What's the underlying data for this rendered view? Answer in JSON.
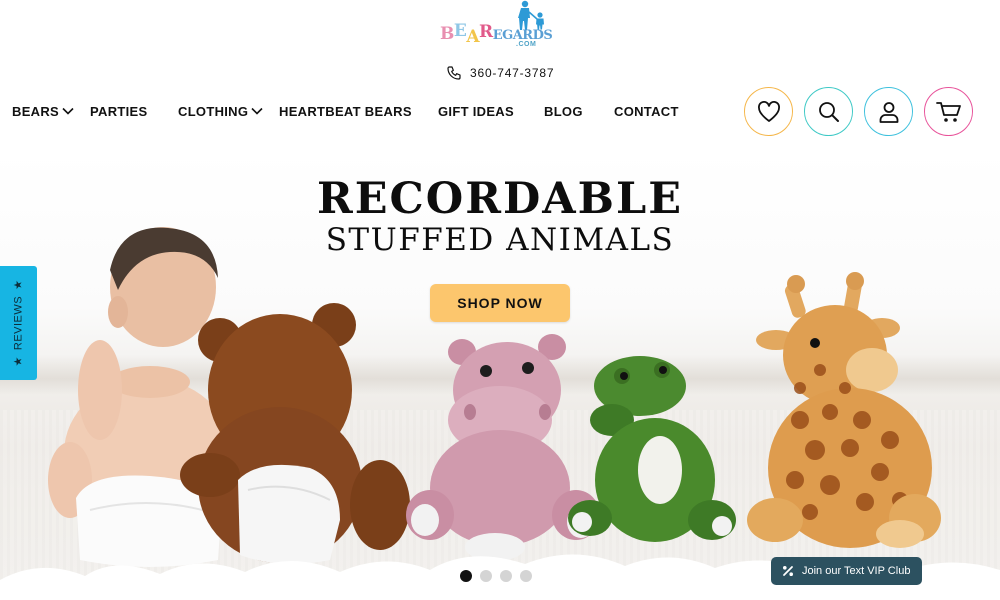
{
  "header": {
    "logo_alt": "BeaRegards.com",
    "logo_letters": [
      {
        "char": "B",
        "color": "#e88fb0"
      },
      {
        "char": "E",
        "color": "#8fc7e6"
      },
      {
        "char": "A",
        "color": "#f2c54a"
      },
      {
        "char": "R",
        "color": "#e15a8a"
      },
      {
        "char": "EGARDS",
        "color": "#5a9fd4"
      }
    ],
    "logo_com": ".COM",
    "phone": "360-747-3787"
  },
  "nav": {
    "items": [
      {
        "label": "BEARS",
        "has_dropdown": true
      },
      {
        "label": "PARTIES",
        "has_dropdown": false
      },
      {
        "label": "CLOTHING",
        "has_dropdown": true
      },
      {
        "label": "HEARTBEAT BEARS",
        "has_dropdown": false
      },
      {
        "label": "GIFT IDEAS",
        "has_dropdown": false
      },
      {
        "label": "BLOG",
        "has_dropdown": false
      },
      {
        "label": "CONTACT",
        "has_dropdown": false
      }
    ]
  },
  "actions": {
    "wishlist": {
      "icon": "heart-icon",
      "color": "#f5b649"
    },
    "search": {
      "icon": "search-icon",
      "color": "#3ec9c6"
    },
    "account": {
      "icon": "user-icon",
      "color": "#3ec1dd"
    },
    "cart": {
      "icon": "cart-icon",
      "color": "#e8539a"
    }
  },
  "hero": {
    "title_line1": "RECORDABLE",
    "title_line2": "STUFFED ANIMALS",
    "cta": "SHOP NOW",
    "cta_color": "#fcc66d",
    "slides_total": 4,
    "active_slide": 1
  },
  "reviews_tab": {
    "label": "REVIEWS",
    "color": "#17b5e3"
  },
  "vip": {
    "label": "Join our Text VIP Club",
    "color": "#2c5160"
  }
}
